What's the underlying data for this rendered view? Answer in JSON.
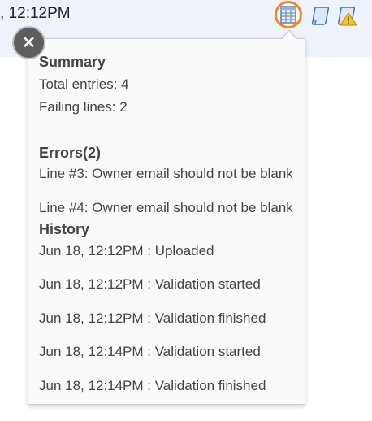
{
  "header": {
    "timestamp": ", 12:12PM",
    "icons": [
      "table-icon",
      "document-icon",
      "warning-document-icon"
    ]
  },
  "popover": {
    "summary": {
      "heading": "Summary",
      "total_entries": "Total entries: 4",
      "failing_lines": "Failing lines: 2"
    },
    "errors": {
      "heading": "Errors(2)",
      "items": [
        "Line #3: Owner email should not be blank",
        "Line #4: Owner email should not be blank"
      ]
    },
    "history": {
      "heading": "History",
      "items": [
        "Jun 18, 12:12PM : Uploaded",
        "Jun 18, 12:12PM : Validation started",
        "Jun 18, 12:12PM : Validation finished",
        "Jun 18, 12:14PM : Validation started",
        "Jun 18, 12:14PM : Validation finished"
      ]
    }
  },
  "colors": {
    "highlight_ring": "#f28a1f",
    "close_button": "#5d5d5d",
    "header_background": "#eef2fb"
  }
}
